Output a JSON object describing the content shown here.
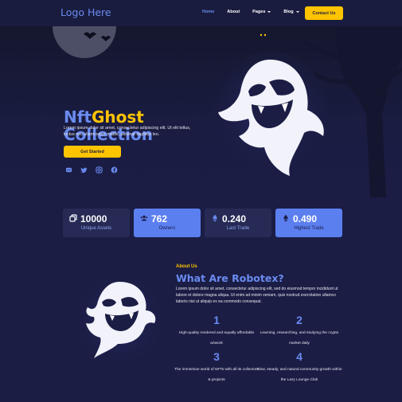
{
  "nav": {
    "logo": "Logo Here",
    "items": [
      {
        "label": "Home",
        "active": true,
        "dropdown": false
      },
      {
        "label": "About",
        "active": false,
        "dropdown": false
      },
      {
        "label": "Pages",
        "active": false,
        "dropdown": true
      },
      {
        "label": "Blog",
        "active": false,
        "dropdown": true
      }
    ],
    "cta": "Contact Us"
  },
  "hero": {
    "title_part1": "Nft",
    "title_part2": "Ghost",
    "title_line2": "Collection",
    "text": "Lorem ipsum dolor sit amet, consectetur adipiscing elit. Ut elit tellus, luctus nec ullamcorper mattis, pulvinar dapibus leo.",
    "button": "Get Started",
    "socials": [
      "discord-icon",
      "twitter-icon",
      "instagram-icon",
      "facebook-icon"
    ]
  },
  "stats": [
    {
      "value": "10000",
      "label": "Unique Assets",
      "icon": "copy-icon",
      "highlight": false
    },
    {
      "value": "762",
      "label": "Owners",
      "icon": "users-icon",
      "highlight": true
    },
    {
      "value": "0.240",
      "label": "Last Trade",
      "icon": "ethereum-icon",
      "highlight": false
    },
    {
      "value": "0.490",
      "label": "Highest Trade",
      "icon": "ethereum-icon",
      "highlight": true
    }
  ],
  "about": {
    "kicker": "About Us",
    "title": "What Are Robotex?",
    "text": "Lorem ipsum dolor sit amet, consectetur adipiscing elit, sed do eiusmod tempor incididunt ut labore et dolore magna aliqua. Ut enim ad minim veniam, quis nostrud exercitation ullamco laboris nisi ut aliquip ex ea commodo consequat.",
    "features": [
      {
        "num": "1",
        "text": "High-quality rendered and equally affordable artwork"
      },
      {
        "num": "2",
        "text": "Learning, researching, and studying the crypto market daily"
      },
      {
        "num": "3",
        "text": "The immersive world of NFTs with all its collectors & projects"
      },
      {
        "num": "4",
        "text": "Slow, steady, and natural community growth within the Lazy Lounge Club"
      }
    ]
  },
  "colors": {
    "accent": "#6a8bf0",
    "yellow": "#ffc400",
    "bg": "#1b1d45"
  }
}
